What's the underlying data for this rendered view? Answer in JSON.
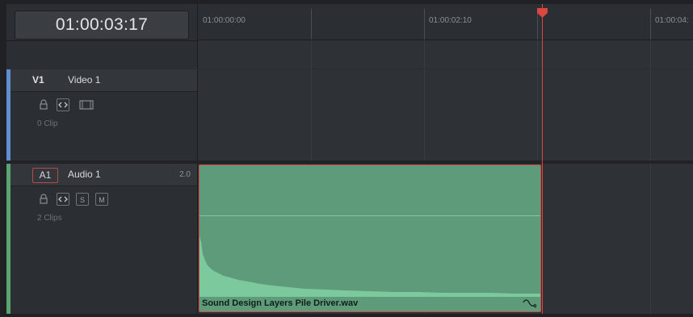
{
  "timecode": "01:00:03:17",
  "ruler": {
    "labels": [
      "01:00:00:00",
      "01:00:02:10",
      "01:00:04:"
    ]
  },
  "tracks": [
    {
      "id": "V1",
      "name": "Video 1",
      "clips": "0 Clip",
      "color": "#5f8fd0",
      "controls": [
        "lock-icon",
        "auto-select-icon",
        "video-disable-icon"
      ]
    },
    {
      "id": "A1",
      "name": "Audio 1",
      "level": "2.0",
      "clips": "2 Clips",
      "color": "#5aa474",
      "controls": [
        "lock-icon",
        "auto-select-icon",
        "S",
        "M"
      ]
    }
  ],
  "clip": {
    "name": "Sound Design Layers Pile Driver.wav",
    "color": "#5e9b7a"
  },
  "colors": {
    "playhead": "#d9473f",
    "selection_border": "#d24a44"
  }
}
